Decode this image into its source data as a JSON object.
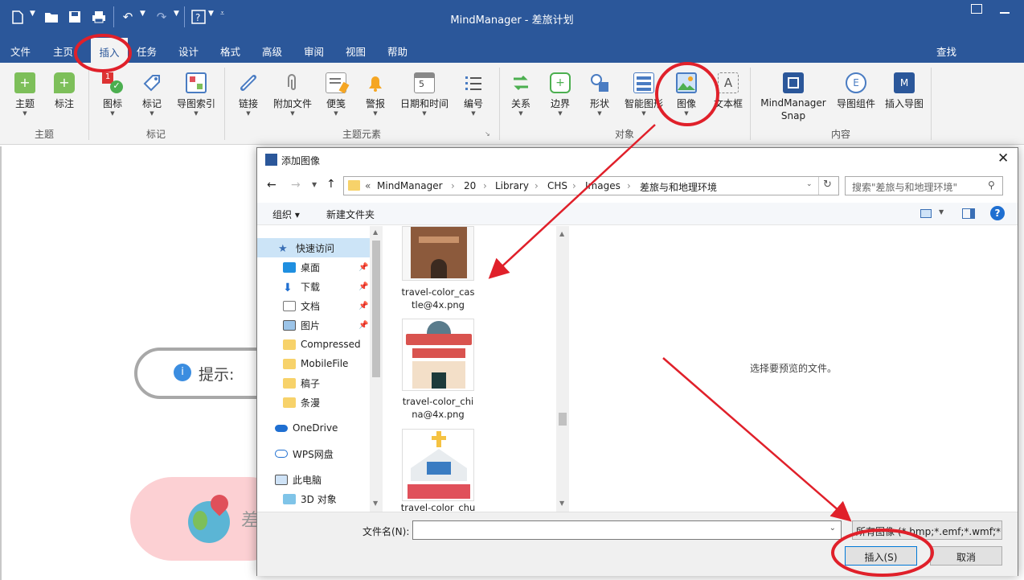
{
  "app": {
    "title": "MindManager - 差旅计划"
  },
  "menu": {
    "tabs": [
      "文件",
      "主页",
      "插入",
      "任务",
      "设计",
      "格式",
      "高级",
      "审阅",
      "视图",
      "帮助"
    ],
    "find": "查找"
  },
  "ribbon": {
    "buttons": [
      "主题",
      "标注",
      "图标",
      "标记",
      "导图索引",
      "链接",
      "附加文件",
      "便笺",
      "警报",
      "日期和时间",
      "编号",
      "关系",
      "边界",
      "形状",
      "智能图形",
      "图像",
      "文本框",
      "MindManager Snap",
      "导图组件",
      "插入导图"
    ],
    "groups": [
      "主题",
      "标记",
      "主题元素",
      "对象",
      "内容"
    ]
  },
  "canvas": {
    "tip": "提示:",
    "topic": "差"
  },
  "dialog": {
    "title": "添加图像",
    "path": [
      "MindManager",
      "20",
      "Library",
      "CHS",
      "Images",
      "差旅与和地理环境"
    ],
    "path_prefix": "«",
    "search_placeholder": "搜索\"差旅与和地理环境\"",
    "organize": "组织 ▾",
    "new_folder": "新建文件夹",
    "nav": [
      "快速访问",
      "桌面",
      "下载",
      "文档",
      "图片",
      "Compressed",
      "MobileFile",
      "稿子",
      "条漫",
      "OneDrive",
      "WPS网盘",
      "此电脑",
      "3D 对象"
    ],
    "files": [
      {
        "name1": "travel-color_cas",
        "name2": "tle@4x.png"
      },
      {
        "name1": "travel-color_chi",
        "name2": "na@4x.png"
      },
      {
        "name1": "travel-color_chu",
        "name2": ""
      }
    ],
    "preview_text": "选择要预览的文件。",
    "filename_label": "文件名(N):",
    "filename_value": "",
    "filetype": "所有图像 (*.bmp;*.emf;*.wmf;*",
    "insert": "插入(S)",
    "cancel": "取消"
  },
  "colors": {
    "brand": "#2b579a",
    "annotation": "#e0202a"
  }
}
